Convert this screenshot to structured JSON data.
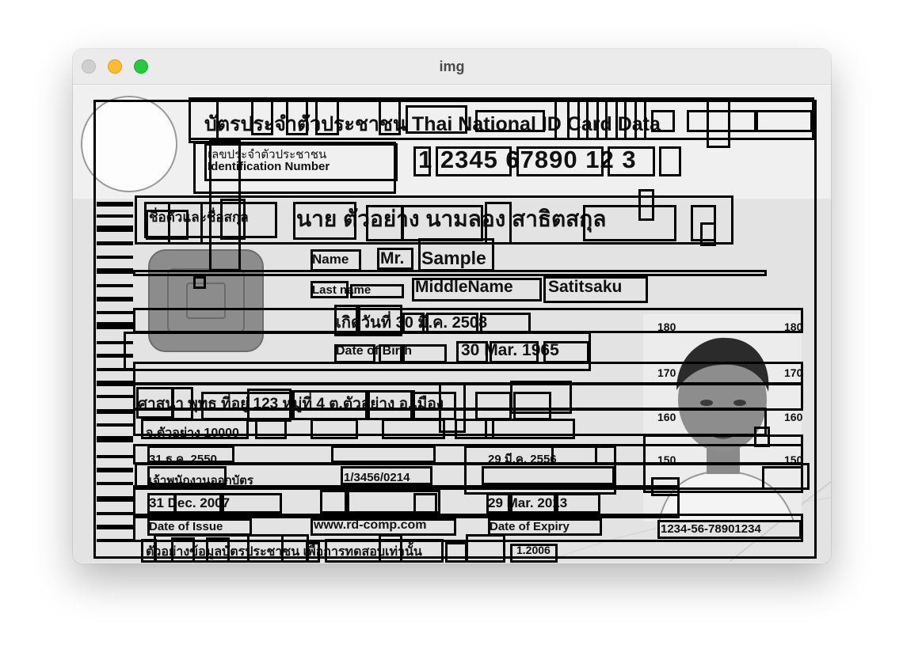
{
  "window": {
    "title": "img"
  },
  "card": {
    "header": "บัตรประจำตัวประชาชน Thai National ID Card Data",
    "id_label_th": "เลขประจำตัวประชาชน",
    "id_label_en": "Identification Number",
    "id_number": "1 2345 67890 12 3",
    "name_label_th": "ชื่อตัวและชื่อสกุล",
    "name_th": "นาย ตัวอย่าง นามลอง สาธิตสกุล",
    "name_label_en": "Name",
    "title_en": "Mr.",
    "first_name_en": "Sample",
    "last_name_label_en": "Last name",
    "middle_name_en": "MiddleName",
    "last_name_en": "Satitsaku",
    "dob_th": "เกิดวันที่ 30 มี.ค. 2508",
    "dob_label_en": "Date of Birth",
    "dob_en": "30 Mar. 1965",
    "religion_line": "ศาสนา พุทธ ที่อยู่ 123 หมู่ที่ 4 ต.ตัวอย่าง อ.เมือง",
    "address_line": "จ.ตัวอย่าง 10000",
    "issue_date_th": "31 ธ.ค. 2550",
    "issue_date_en": "31 Dec. 2007",
    "issue_label_en": "Date of Issue",
    "officer_label": "เจ้าพนักงานออกบัตร",
    "officer_code": "1/3456/0214",
    "expiry_date_th": "29 มี.ค. 2556",
    "expiry_date_en": "29 Mar. 2013",
    "expiry_label_en": "Date of Expiry",
    "website": "www.rd-comp.com",
    "serial": "1234-56-78901234",
    "bottom_line": "ตัวอย่างข้อมูลบัตรประชาชน เพื่อการทดสอบเท่านั้น",
    "bottom_code": "1.2006",
    "height_ticks": [
      "180",
      "170",
      "160",
      "150"
    ]
  }
}
